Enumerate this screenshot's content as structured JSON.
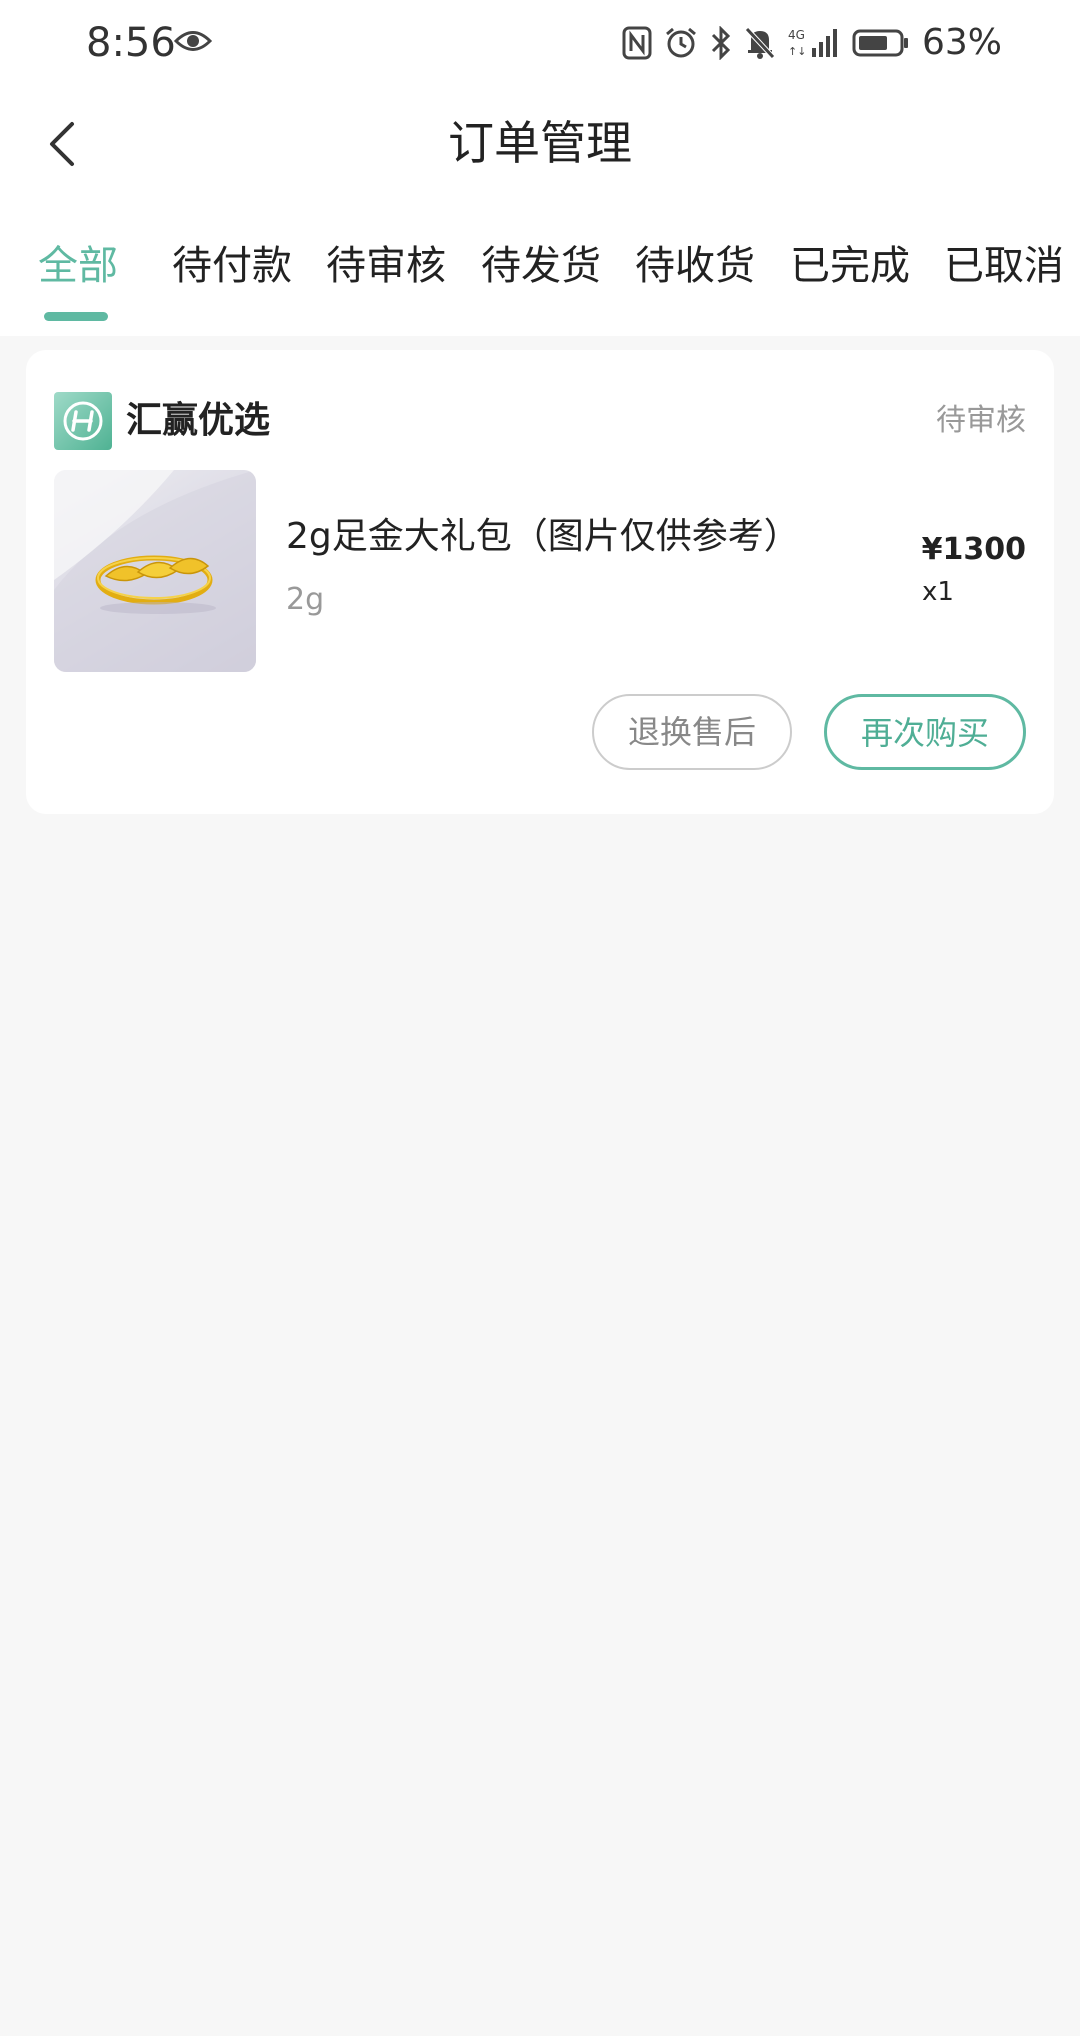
{
  "status_bar": {
    "time": "8:56",
    "battery": "63%",
    "icons": [
      "eye-icon",
      "nfc-icon",
      "alarm-icon",
      "bluetooth-icon",
      "mute-icon",
      "signal-icon",
      "battery-icon"
    ]
  },
  "header": {
    "title": "订单管理",
    "back_icon": "chevron-left-icon"
  },
  "tabs": [
    {
      "label": "全部",
      "active": true
    },
    {
      "label": "待付款",
      "active": false
    },
    {
      "label": "待审核",
      "active": false
    },
    {
      "label": "待发货",
      "active": false
    },
    {
      "label": "待收货",
      "active": false
    },
    {
      "label": "已完成",
      "active": false
    },
    {
      "label": "已取消",
      "active": false
    }
  ],
  "order": {
    "shop_name": "汇赢优选",
    "status": "待审核",
    "product": {
      "name": "2g足金大礼包（图片仅供参考）",
      "spec": "2g",
      "price": "¥1300",
      "quantity": "x1"
    },
    "actions": {
      "after_sale": "退换售后",
      "rebuy": "再次购买"
    }
  },
  "colors": {
    "accent": "#5fb9a2",
    "background": "#f7f7f7",
    "card": "#ffffff",
    "muted_text": "#999999"
  }
}
